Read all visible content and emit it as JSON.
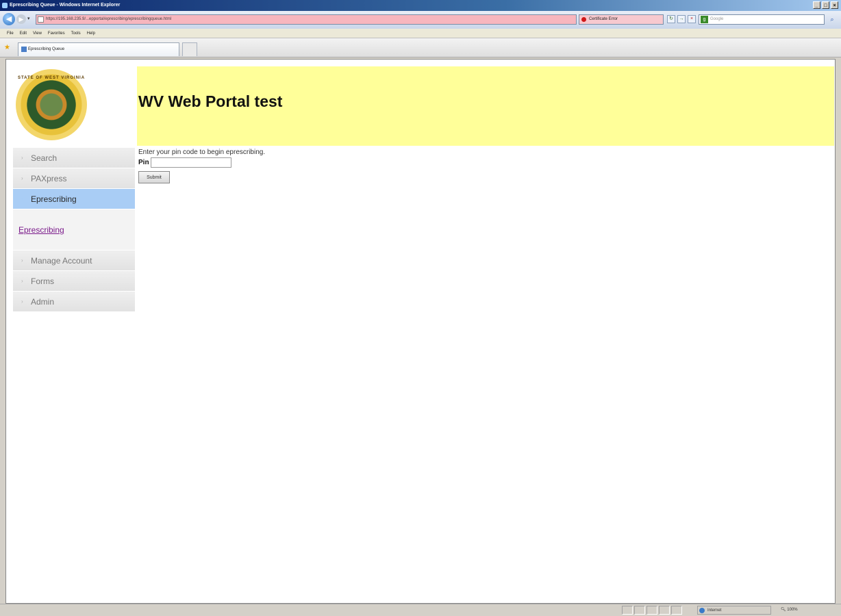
{
  "window": {
    "title": "Eprescribing Queue - Windows Internet Explorer",
    "controls": [
      "_",
      "□",
      "×"
    ]
  },
  "browser": {
    "address": "https://195.168.235.9/...epportal/eprescribing/eprescribingqueue.html",
    "certificate_label": "Certificate Error",
    "search_placeholder": "Google",
    "menu": [
      "File",
      "Edit",
      "View",
      "Favorites",
      "Tools",
      "Help"
    ],
    "tab_title": "Eprescribing Queue",
    "status_zone": "Internet",
    "zoom": "100%"
  },
  "page": {
    "logo_text_top": "STATE OF WEST VIRGINIA",
    "title": "WV Web Portal test",
    "sidebar": {
      "items": [
        {
          "label": "Search",
          "active": false
        },
        {
          "label": "PAXpress",
          "active": false
        },
        {
          "label": "Eprescribing",
          "active": true
        }
      ],
      "sub_link": "Eprescribing",
      "items_after": [
        {
          "label": "Manage Account"
        },
        {
          "label": "Forms"
        },
        {
          "label": "Admin"
        }
      ]
    },
    "form": {
      "prompt": "Enter your pin code to begin eprescribing.",
      "pin_label": "Pin",
      "pin_value": "",
      "submit_label": "Submit"
    }
  },
  "colors": {
    "header_band": "#ffff99",
    "active_nav": "#a9cdf5",
    "sub_link": "#7a1a8a"
  }
}
